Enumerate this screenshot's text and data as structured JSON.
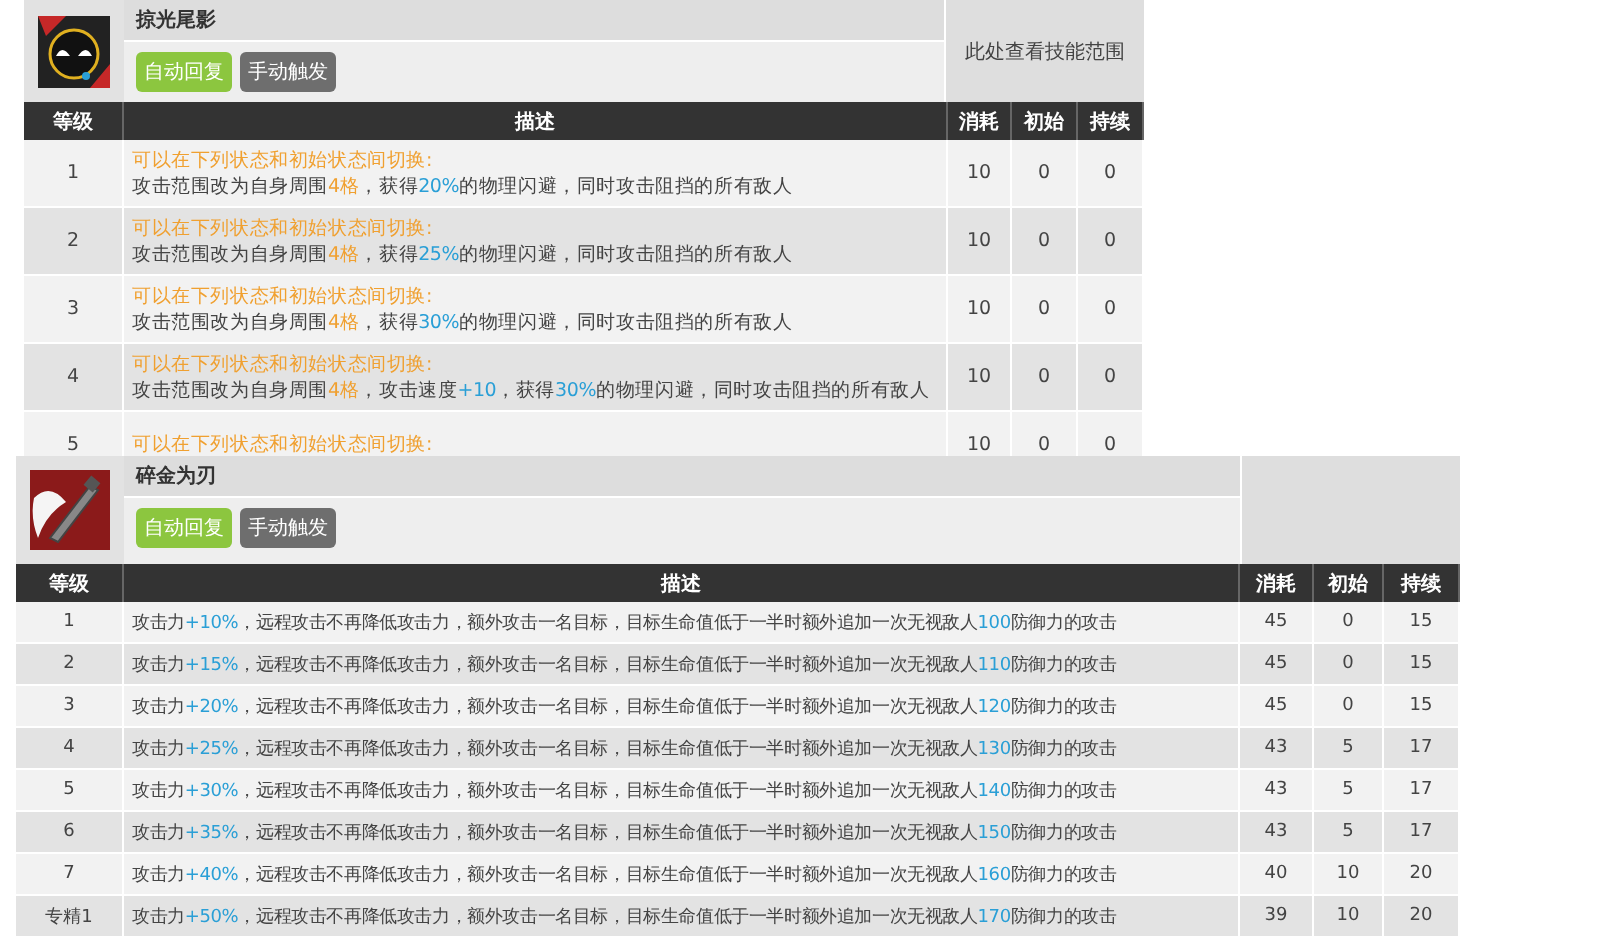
{
  "skills": [
    {
      "name": "掠光尾影",
      "badges": [
        {
          "label": "自动回复",
          "kind": "auto"
        },
        {
          "label": "手动触发",
          "kind": "manual"
        }
      ],
      "range_note": "此处查看技能范围",
      "columns": [
        "等级",
        "描述",
        "消耗",
        "初始",
        "持续"
      ],
      "rows": [
        {
          "level": "1",
          "note": "可以在下列状态和初始状态间切换:",
          "parts": [
            {
              "text": "攻击范围改为自身周围",
              "kind": "plain"
            },
            {
              "text": "4格",
              "kind": "orange"
            },
            {
              "text": "，获得",
              "kind": "plain"
            },
            {
              "text": "20%",
              "kind": "blue"
            },
            {
              "text": "的物理闪避，同时攻击阻挡的所有敌人",
              "kind": "plain"
            }
          ],
          "cost": "10",
          "initial": "0",
          "duration": "0"
        },
        {
          "level": "2",
          "note": "可以在下列状态和初始状态间切换:",
          "parts": [
            {
              "text": "攻击范围改为自身周围",
              "kind": "plain"
            },
            {
              "text": "4格",
              "kind": "orange"
            },
            {
              "text": "，获得",
              "kind": "plain"
            },
            {
              "text": "25%",
              "kind": "blue"
            },
            {
              "text": "的物理闪避，同时攻击阻挡的所有敌人",
              "kind": "plain"
            }
          ],
          "cost": "10",
          "initial": "0",
          "duration": "0"
        },
        {
          "level": "3",
          "note": "可以在下列状态和初始状态间切换:",
          "parts": [
            {
              "text": "攻击范围改为自身周围",
              "kind": "plain"
            },
            {
              "text": "4格",
              "kind": "orange"
            },
            {
              "text": "，获得",
              "kind": "plain"
            },
            {
              "text": "30%",
              "kind": "blue"
            },
            {
              "text": "的物理闪避，同时攻击阻挡的所有敌人",
              "kind": "plain"
            }
          ],
          "cost": "10",
          "initial": "0",
          "duration": "0"
        },
        {
          "level": "4",
          "note": "可以在下列状态和初始状态间切换:",
          "parts": [
            {
              "text": "攻击范围改为自身周围",
              "kind": "plain"
            },
            {
              "text": "4格",
              "kind": "orange"
            },
            {
              "text": "，攻击速度",
              "kind": "plain"
            },
            {
              "text": "+10",
              "kind": "blue"
            },
            {
              "text": "，获得",
              "kind": "plain"
            },
            {
              "text": "30%",
              "kind": "blue"
            },
            {
              "text": "的物理闪避，同时攻击阻挡的所有敌人",
              "kind": "plain"
            }
          ],
          "cost": "10",
          "initial": "0",
          "duration": "0"
        },
        {
          "level": "5",
          "note": "可以在下列状态和初始状态间切换:",
          "cost": "10",
          "initial": "0",
          "duration": "0"
        }
      ]
    },
    {
      "name": "碎金为刃",
      "badges": [
        {
          "label": "自动回复",
          "kind": "auto"
        },
        {
          "label": "手动触发",
          "kind": "manual"
        }
      ],
      "columns": [
        "等级",
        "描述",
        "消耗",
        "初始",
        "持续"
      ],
      "rows": [
        {
          "level": "1",
          "parts": [
            {
              "text": "攻击力",
              "kind": "plain"
            },
            {
              "text": "+10%",
              "kind": "blue"
            },
            {
              "text": "，远程攻击不再降低攻击力，额外攻击一名目标，目标生命值低于一半时额外追加一次无视敌人",
              "kind": "plain"
            },
            {
              "text": "100",
              "kind": "blue"
            },
            {
              "text": "防御力的攻击",
              "kind": "plain"
            }
          ],
          "cost": "45",
          "initial": "0",
          "duration": "15"
        },
        {
          "level": "2",
          "parts": [
            {
              "text": "攻击力",
              "kind": "plain"
            },
            {
              "text": "+15%",
              "kind": "blue"
            },
            {
              "text": "，远程攻击不再降低攻击力，额外攻击一名目标，目标生命值低于一半时额外追加一次无视敌人",
              "kind": "plain"
            },
            {
              "text": "110",
              "kind": "blue"
            },
            {
              "text": "防御力的攻击",
              "kind": "plain"
            }
          ],
          "cost": "45",
          "initial": "0",
          "duration": "15"
        },
        {
          "level": "3",
          "parts": [
            {
              "text": "攻击力",
              "kind": "plain"
            },
            {
              "text": "+20%",
              "kind": "blue"
            },
            {
              "text": "，远程攻击不再降低攻击力，额外攻击一名目标，目标生命值低于一半时额外追加一次无视敌人",
              "kind": "plain"
            },
            {
              "text": "120",
              "kind": "blue"
            },
            {
              "text": "防御力的攻击",
              "kind": "plain"
            }
          ],
          "cost": "45",
          "initial": "0",
          "duration": "15"
        },
        {
          "level": "4",
          "parts": [
            {
              "text": "攻击力",
              "kind": "plain"
            },
            {
              "text": "+25%",
              "kind": "blue"
            },
            {
              "text": "，远程攻击不再降低攻击力，额外攻击一名目标，目标生命值低于一半时额外追加一次无视敌人",
              "kind": "plain"
            },
            {
              "text": "130",
              "kind": "blue"
            },
            {
              "text": "防御力的攻击",
              "kind": "plain"
            }
          ],
          "cost": "43",
          "initial": "5",
          "duration": "17"
        },
        {
          "level": "5",
          "parts": [
            {
              "text": "攻击力",
              "kind": "plain"
            },
            {
              "text": "+30%",
              "kind": "blue"
            },
            {
              "text": "，远程攻击不再降低攻击力，额外攻击一名目标，目标生命值低于一半时额外追加一次无视敌人",
              "kind": "plain"
            },
            {
              "text": "140",
              "kind": "blue"
            },
            {
              "text": "防御力的攻击",
              "kind": "plain"
            }
          ],
          "cost": "43",
          "initial": "5",
          "duration": "17"
        },
        {
          "level": "6",
          "parts": [
            {
              "text": "攻击力",
              "kind": "plain"
            },
            {
              "text": "+35%",
              "kind": "blue"
            },
            {
              "text": "，远程攻击不再降低攻击力，额外攻击一名目标，目标生命值低于一半时额外追加一次无视敌人",
              "kind": "plain"
            },
            {
              "text": "150",
              "kind": "blue"
            },
            {
              "text": "防御力的攻击",
              "kind": "plain"
            }
          ],
          "cost": "43",
          "initial": "5",
          "duration": "17"
        },
        {
          "level": "7",
          "parts": [
            {
              "text": "攻击力",
              "kind": "plain"
            },
            {
              "text": "+40%",
              "kind": "blue"
            },
            {
              "text": "，远程攻击不再降低攻击力，额外攻击一名目标，目标生命值低于一半时额外追加一次无视敌人",
              "kind": "plain"
            },
            {
              "text": "160",
              "kind": "blue"
            },
            {
              "text": "防御力的攻击",
              "kind": "plain"
            }
          ],
          "cost": "40",
          "initial": "10",
          "duration": "20"
        },
        {
          "level": "专精1",
          "parts": [
            {
              "text": "攻击力",
              "kind": "plain"
            },
            {
              "text": "+50%",
              "kind": "blue"
            },
            {
              "text": "，远程攻击不再降低攻击力，额外攻击一名目标，目标生命值低于一半时额外追加一次无视敌人",
              "kind": "plain"
            },
            {
              "text": "170",
              "kind": "blue"
            },
            {
              "text": "防御力的攻击",
              "kind": "plain"
            }
          ],
          "cost": "39",
          "initial": "10",
          "duration": "20"
        }
      ]
    }
  ]
}
